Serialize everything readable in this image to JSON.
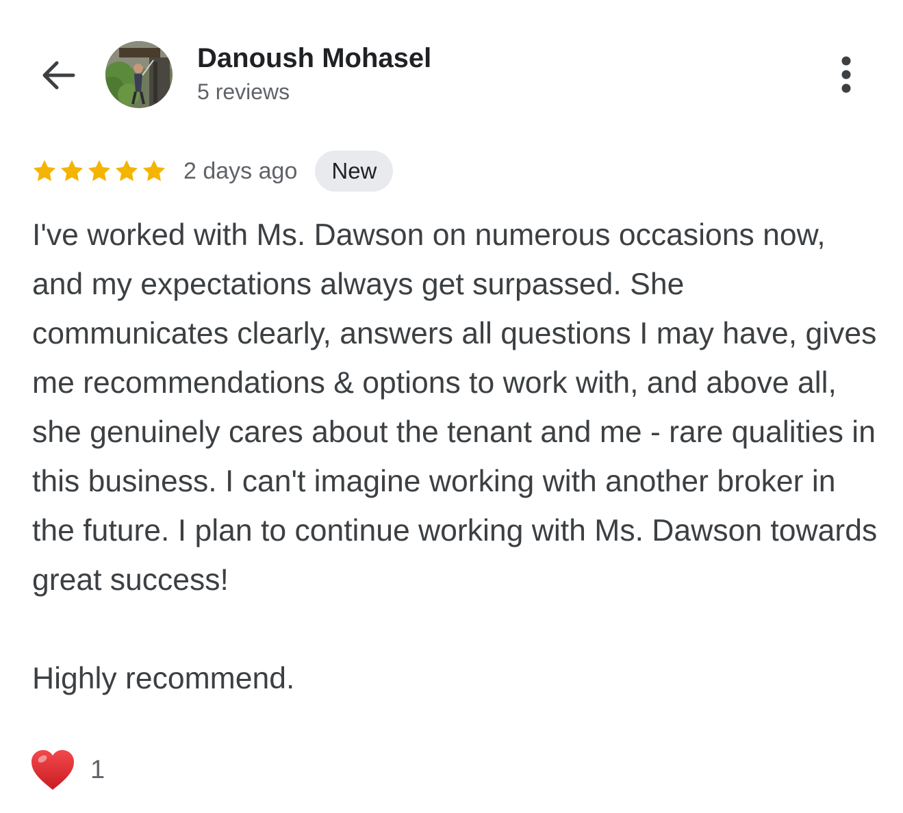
{
  "reviewer": {
    "name": "Danoush Mohasel",
    "reviews_count": "5 reviews"
  },
  "review": {
    "rating": 5,
    "max_rating": 5,
    "date": "2 days ago",
    "badge": "New",
    "text": "I've worked with Ms. Dawson on numerous occasions now, and my expectations always get surpassed. She communicates clearly, answers all questions I may have, gives me recommendations & options to work with, and above all, she genuinely cares about the tenant and me - rare qualities in this business. I can't imagine working with another broker in the future. I plan to continue working with Ms. Dawson towards great success!\n\nHighly recommend."
  },
  "reactions": {
    "heart_count": "1"
  },
  "icons": {
    "back": "arrow-left-icon",
    "more": "more-vertical-icon",
    "star": "star-icon",
    "reaction": "heart-icon"
  },
  "colors": {
    "star": "#F4B400",
    "badge_bg": "#E8EAED",
    "heart": "#E0262B",
    "secondary_text": "#5F6368",
    "body_text": "#3C4043"
  }
}
